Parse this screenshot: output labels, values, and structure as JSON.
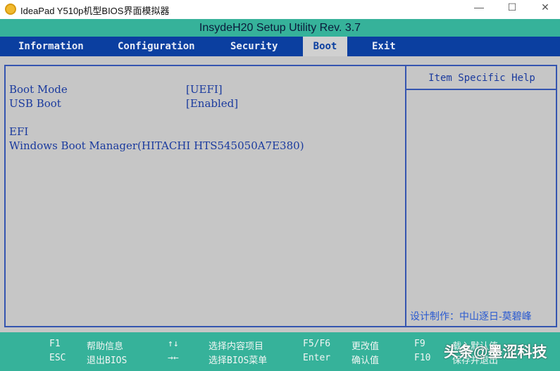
{
  "window": {
    "title": "IdeaPad Y510p机型BIOS界面模拟器",
    "minimize": "—",
    "maximize": "☐",
    "close": "✕"
  },
  "header": {
    "title": "InsydeH20 Setup Utility Rev. 3.7"
  },
  "tabs": [
    {
      "label": "Information"
    },
    {
      "label": "Configuration"
    },
    {
      "label": "Security"
    },
    {
      "label": "Boot"
    },
    {
      "label": "Exit"
    }
  ],
  "settings": [
    {
      "label": "Boot Mode",
      "value": "[UEFI]"
    },
    {
      "label": "USB Boot",
      "value": "[Enabled]"
    }
  ],
  "efi": {
    "heading": "EFI",
    "item": "Windows Boot Manager(HITACHI HTS545050A7E380)"
  },
  "help": {
    "title": "Item Specific Help",
    "credit": "设计制作：中山逐日-莫碧峰"
  },
  "footer": [
    {
      "key1": "F1",
      "desc1": "帮助信息",
      "key2": "ESC",
      "desc2": "退出BIOS"
    },
    {
      "key1": "↑↓",
      "desc1": "选择内容项目",
      "key2": "→←",
      "desc2": "选择BIOS菜单"
    },
    {
      "key1": "F5/F6",
      "desc1": "更改值",
      "key2": "Enter",
      "desc2": "确认值"
    },
    {
      "key1": "F9",
      "desc1": "载入默认值",
      "key2": "F10",
      "desc2": "保存并退出"
    }
  ],
  "watermark": "头条@墨涩科技"
}
